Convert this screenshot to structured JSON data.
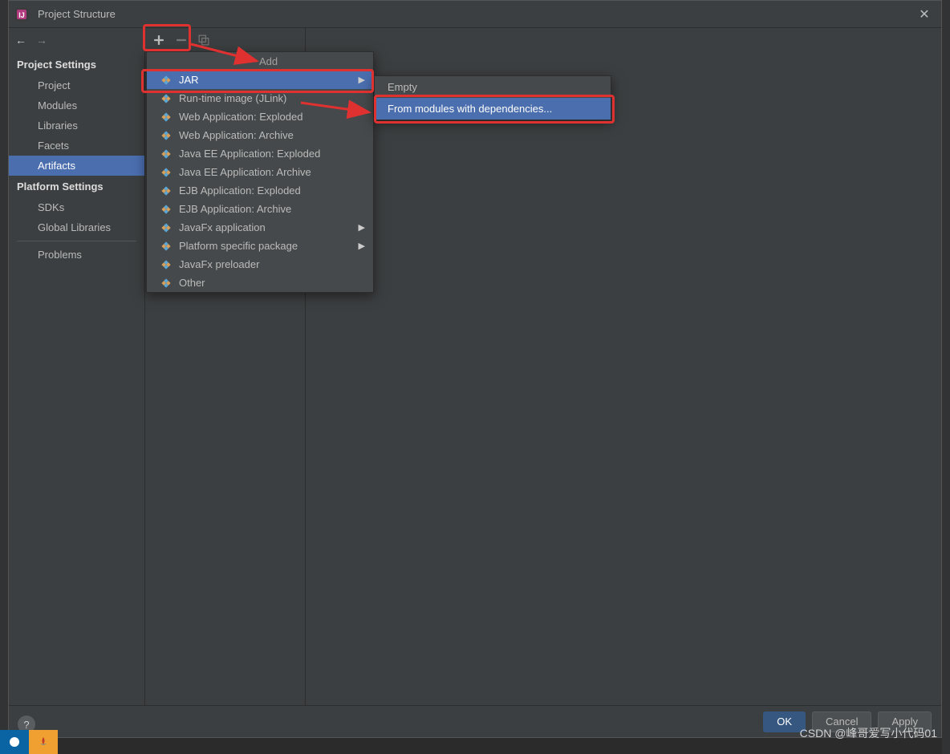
{
  "titlebar": {
    "title": "Project Structure"
  },
  "sidebar": {
    "section1": "Project Settings",
    "items1": [
      {
        "label": "Project"
      },
      {
        "label": "Modules"
      },
      {
        "label": "Libraries"
      },
      {
        "label": "Facets"
      },
      {
        "label": "Artifacts"
      }
    ],
    "section2": "Platform Settings",
    "items2": [
      {
        "label": "SDKs"
      },
      {
        "label": "Global Libraries"
      }
    ],
    "items3": [
      {
        "label": "Problems"
      }
    ]
  },
  "add_menu": {
    "title": "Add",
    "items": [
      {
        "label": "JAR",
        "has_sub": true,
        "selected": true
      },
      {
        "label": "Run-time image (JLink)"
      },
      {
        "label": "Web Application: Exploded"
      },
      {
        "label": "Web Application: Archive"
      },
      {
        "label": "Java EE Application: Exploded"
      },
      {
        "label": "Java EE Application: Archive"
      },
      {
        "label": "EJB Application: Exploded"
      },
      {
        "label": "EJB Application: Archive"
      },
      {
        "label": "JavaFx application",
        "has_sub": true
      },
      {
        "label": "Platform specific package",
        "has_sub": true
      },
      {
        "label": "JavaFx preloader"
      },
      {
        "label": "Other"
      }
    ]
  },
  "sub_menu": {
    "items": [
      {
        "label": "Empty"
      },
      {
        "label": "From modules with dependencies...",
        "selected": true
      }
    ]
  },
  "footer": {
    "ok": "OK",
    "cancel": "Cancel",
    "apply": "Apply",
    "help": "?"
  },
  "watermark": "CSDN @峰哥爱写小代码01"
}
